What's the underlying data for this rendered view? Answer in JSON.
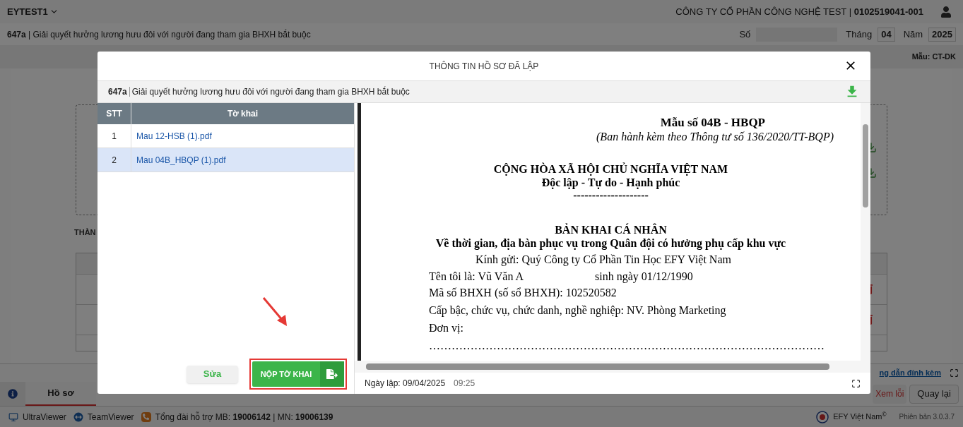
{
  "app_bar": {
    "account": "EYTEST1",
    "company": "CÔNG TY CỔ PHẦN CÔNG NGHỆ TEST | **0102519041-001**"
  },
  "form_bar": {
    "title": "**647a** | Giải quyết hưởng lương hưu đôi với người đang tham gia BHXH bắt buộc",
    "number_label": "Số",
    "month_label": "Tháng",
    "month": "04",
    "year_label": "Năm",
    "year": "2025"
  },
  "template_label": "Mẫu: CT-DK",
  "background": {
    "section_heading": "THÀN",
    "attachment_link": "ng dẫn đính kèm",
    "buttons": [
      {
        "label": "Xem lỗi",
        "kind": "danger"
      },
      {
        "label": "Quay lại",
        "kind": "default"
      }
    ]
  },
  "tabs": [
    {
      "label": "Hồ sơ",
      "selected": true
    }
  ],
  "modal": {
    "title": "THÔNG TIN HỒ SƠ ĐÃ LẬP",
    "code": "647a",
    "subject": "Giải quyết hưởng lương hưu đôi với người đang tham gia BHXH bắt buộc",
    "columns": [
      "STT",
      "Tờ khai"
    ],
    "files": [
      {
        "index": "1",
        "name": "Mau 12-HSB (1).pdf",
        "selected": false
      },
      {
        "index": "2",
        "name": "Mau 04B_HBQP (1).pdf",
        "selected": true
      }
    ],
    "edit_button": "Sửa",
    "submit_button": "NỘP TỜ KHAI",
    "document": [
      {
        "kind": "form_no",
        "text": "Mẫu số 04B - HBQP"
      },
      {
        "kind": "issued",
        "text": "(Ban hành kèm theo Thông tư số 136/2020/TT-BQP)"
      },
      {
        "kind": "heading",
        "text": "CỘNG HÒA XÃ HỘI CHỦ NGHĨA VIỆT NAM"
      },
      {
        "kind": "motto",
        "text": "Độc lập - Tự do - Hạnh phúc"
      },
      {
        "kind": "motto",
        "text": "--------------------"
      },
      {
        "kind": "title",
        "text": "BẢN KHAI CÁ NHÂN"
      },
      {
        "kind": "motto",
        "text": "Về thời gian, địa bàn phục vụ trong Quân đội có hưởng phụ cấp khu vực"
      },
      {
        "kind": "addressee",
        "text": "Kính gửi: Quý Công ty Cổ Phần Tin Học EFY Việt Nam"
      },
      {
        "kind": "pair",
        "text": "Tên tôi là: Vũ Văn A",
        "extra": "sinh ngày 01/12/1990"
      },
      {
        "kind": "field",
        "text": "Mã số BHXH (số sổ BHXH): 102520582"
      },
      {
        "kind": "field",
        "text": "Cấp bậc, chức vụ, chức danh, nghề nghiệp: NV. Phòng Marketing"
      },
      {
        "kind": "field",
        "text": "Đơn vị:"
      },
      {
        "kind": "field",
        "text": "……………………………………………………………………………………………"
      }
    ],
    "created_label": "Ngày lập: 09/04/2025",
    "created_time": "09:25"
  },
  "status_bar": {
    "items": [
      {
        "kind": "monitor",
        "label": "UltraViewer"
      },
      {
        "kind": "remote",
        "label": "TeamViewer"
      },
      {
        "kind": "phone",
        "label": "Tổng đài hỗ trợ MB: **19006142** | MN: **19006139**"
      }
    ],
    "brand": "EFY Việt Nam$^{©}$",
    "version": "Phiên bản 3.0.3.7"
  }
}
